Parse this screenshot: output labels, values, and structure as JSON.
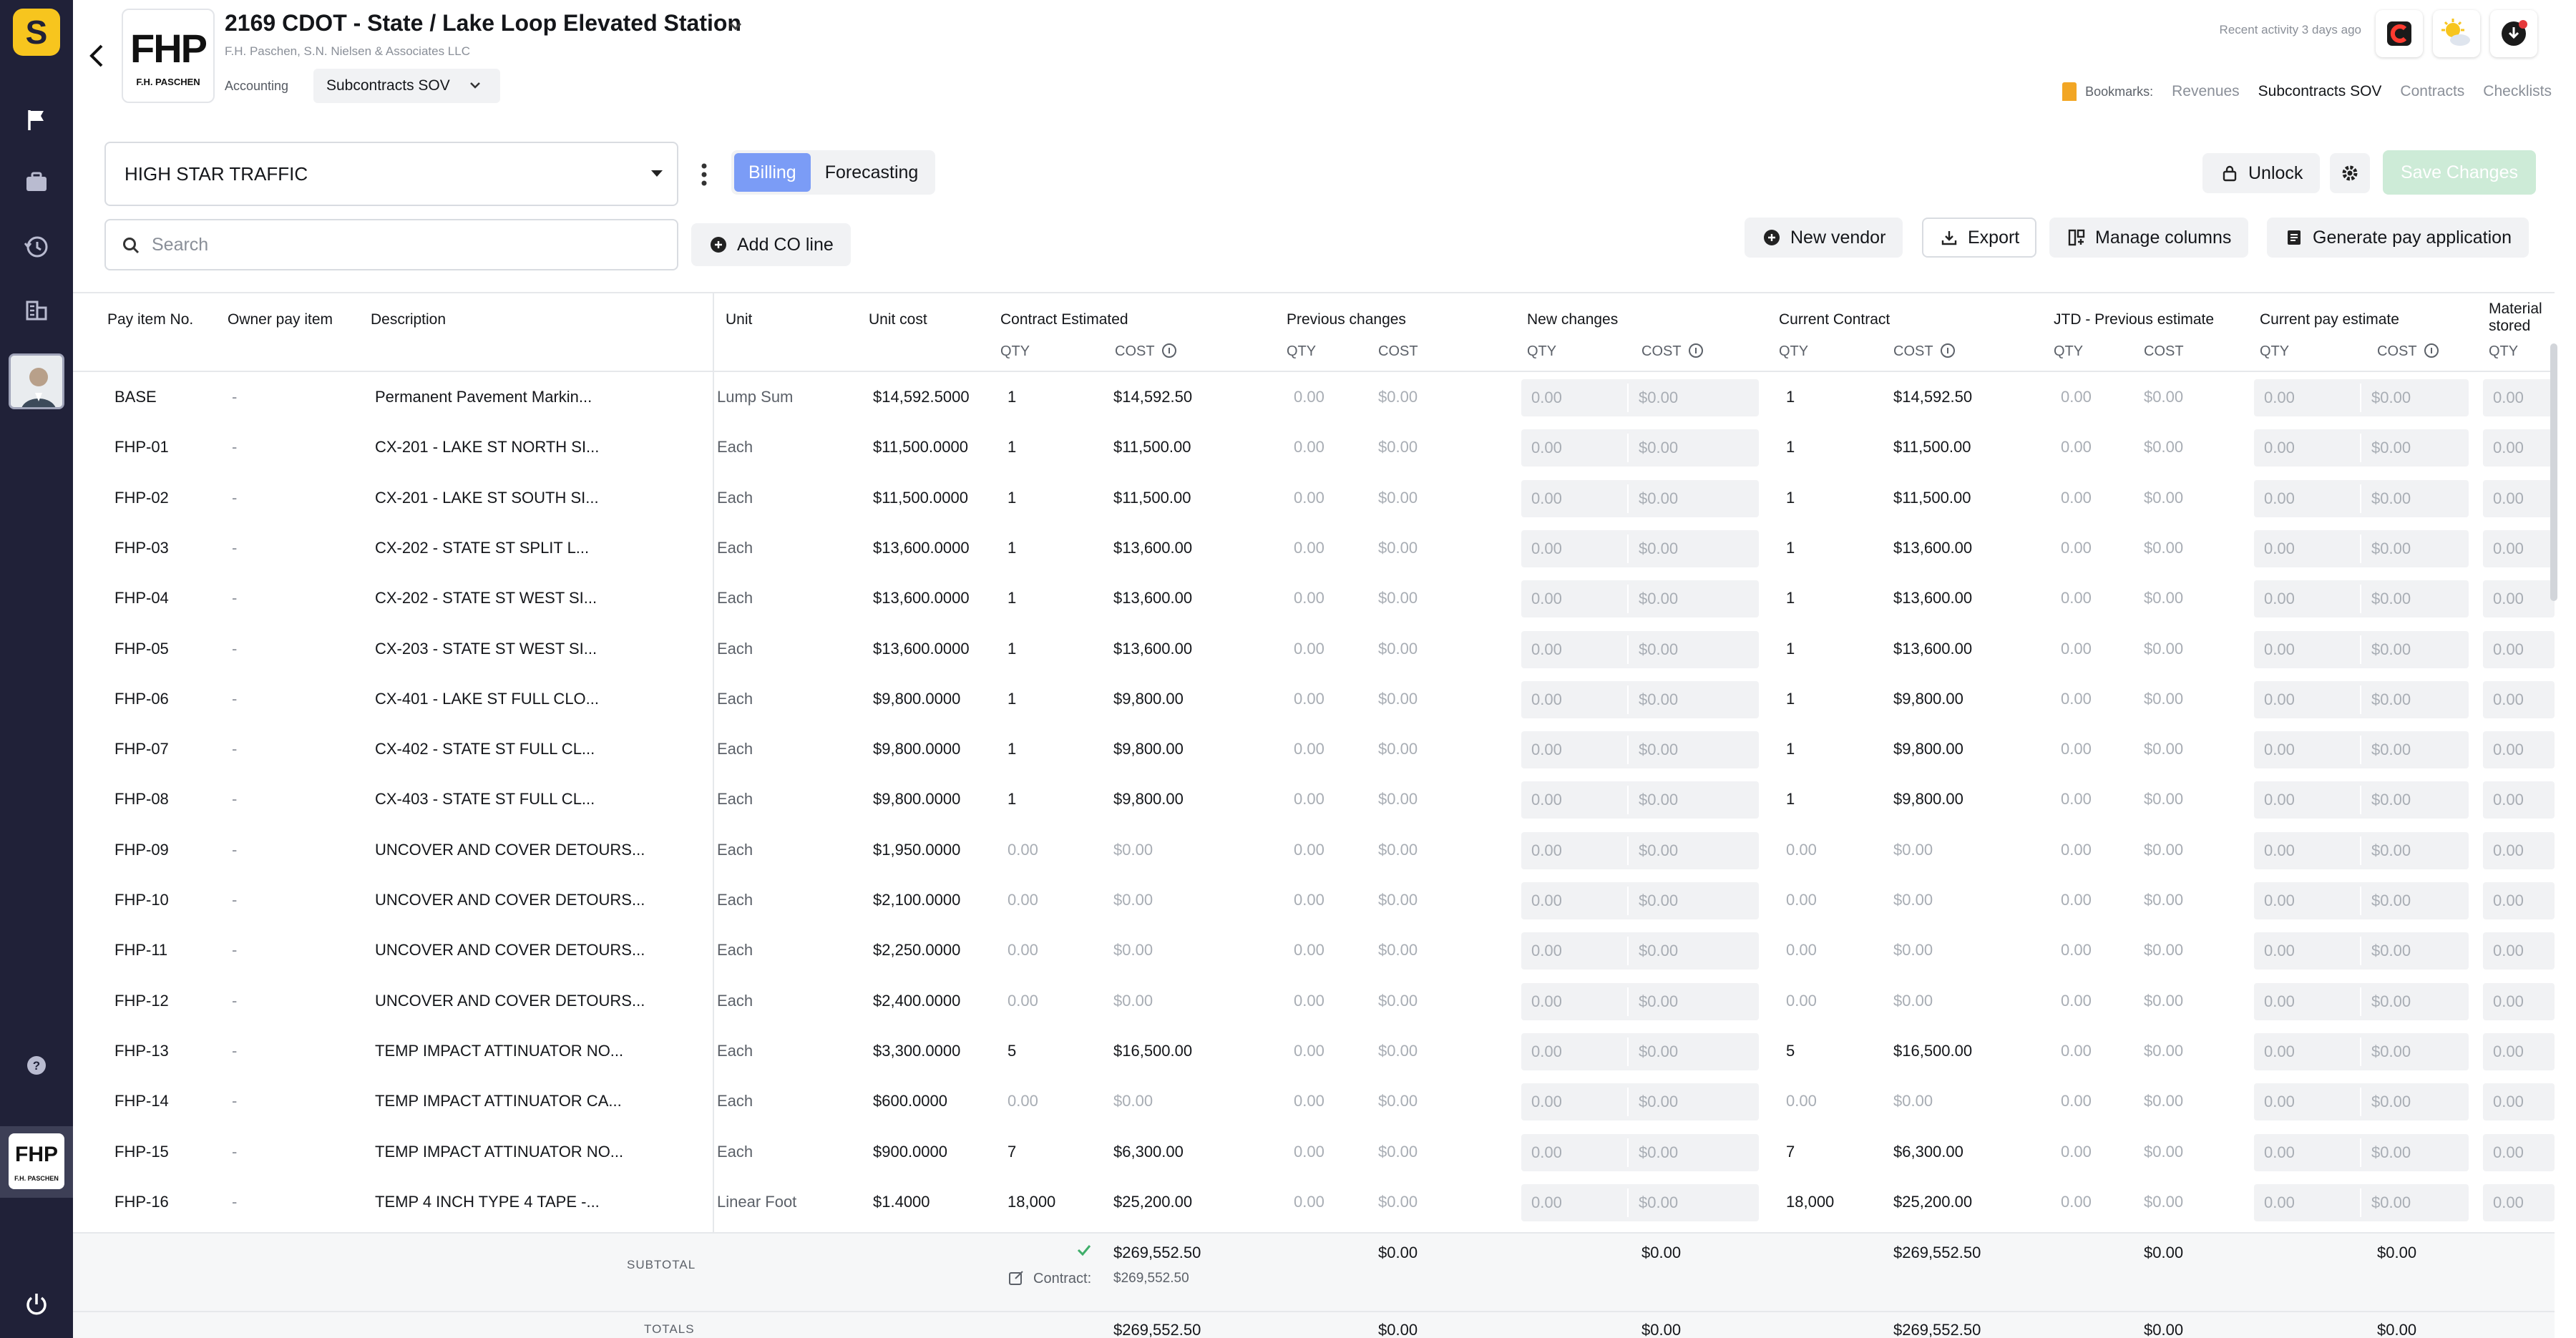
{
  "project": {
    "title": "2169 CDOT - State / Lake Loop Elevated Station",
    "subtitle": "F.H. Paschen, S.N. Nielsen & Associates LLC",
    "logo_text": "FHP",
    "logo_caption": "F.H. PASCHEN",
    "category": "Accounting",
    "section": "Subcontracts SOV"
  },
  "header": {
    "recent_activity": "Recent activity 3 days ago",
    "bookmarks_label": "Bookmarks:",
    "bookmarks": [
      "Revenues",
      "Subcontracts SOV",
      "Contracts",
      "Checklists"
    ],
    "active_bookmark": "Subcontracts SOV"
  },
  "app": {
    "logo_letter": "S",
    "company_logo_text": "FHP",
    "company_logo_caption": "F.H. PASCHEN"
  },
  "toolbar": {
    "vendor": "HIGH STAR TRAFFIC",
    "tabs": [
      "Billing",
      "Forecasting"
    ],
    "active_tab": "Billing",
    "unlock_label": "Unlock",
    "save_label": "Save Changes",
    "search_placeholder": "Search",
    "add_co_label": "Add CO line",
    "new_vendor_label": "New vendor",
    "export_label": "Export",
    "manage_columns_label": "Manage columns",
    "generate_pay_label": "Generate pay application"
  },
  "table": {
    "columns": {
      "pay_item": "Pay item No.",
      "owner_pay_item": "Owner pay item",
      "description": "Description",
      "unit": "Unit",
      "unit_cost": "Unit cost",
      "contract_estimated": "Contract Estimated",
      "previous_changes": "Previous changes",
      "new_changes": "New changes",
      "current_contract": "Current Contract",
      "jtd_previous": "JTD - Previous estimate",
      "current_pay": "Current pay estimate",
      "material_stored": "Material stored",
      "qty": "QTY",
      "cost": "COST"
    },
    "rows": [
      {
        "no": "BASE",
        "owner": "-",
        "desc": "Permanent Pavement Markin...",
        "unit": "Lump Sum",
        "unit_cost": "$14,592.5000",
        "ce_qty": "1",
        "ce_cost": "$14,592.50",
        "cc_qty": "1",
        "cc_cost": "$14,592.50"
      },
      {
        "no": "FHP-01",
        "owner": "-",
        "desc": "CX-201 - LAKE ST NORTH SI...",
        "unit": "Each",
        "unit_cost": "$11,500.0000",
        "ce_qty": "1",
        "ce_cost": "$11,500.00",
        "cc_qty": "1",
        "cc_cost": "$11,500.00"
      },
      {
        "no": "FHP-02",
        "owner": "-",
        "desc": "CX-201 - LAKE ST SOUTH SI...",
        "unit": "Each",
        "unit_cost": "$11,500.0000",
        "ce_qty": "1",
        "ce_cost": "$11,500.00",
        "cc_qty": "1",
        "cc_cost": "$11,500.00"
      },
      {
        "no": "FHP-03",
        "owner": "-",
        "desc": "CX-202 - STATE ST SPLIT L...",
        "unit": "Each",
        "unit_cost": "$13,600.0000",
        "ce_qty": "1",
        "ce_cost": "$13,600.00",
        "cc_qty": "1",
        "cc_cost": "$13,600.00"
      },
      {
        "no": "FHP-04",
        "owner": "-",
        "desc": "CX-202 - STATE ST WEST SI...",
        "unit": "Each",
        "unit_cost": "$13,600.0000",
        "ce_qty": "1",
        "ce_cost": "$13,600.00",
        "cc_qty": "1",
        "cc_cost": "$13,600.00"
      },
      {
        "no": "FHP-05",
        "owner": "-",
        "desc": "CX-203 - STATE ST WEST SI...",
        "unit": "Each",
        "unit_cost": "$13,600.0000",
        "ce_qty": "1",
        "ce_cost": "$13,600.00",
        "cc_qty": "1",
        "cc_cost": "$13,600.00"
      },
      {
        "no": "FHP-06",
        "owner": "-",
        "desc": "CX-401 - LAKE ST FULL CLO...",
        "unit": "Each",
        "unit_cost": "$9,800.0000",
        "ce_qty": "1",
        "ce_cost": "$9,800.00",
        "cc_qty": "1",
        "cc_cost": "$9,800.00"
      },
      {
        "no": "FHP-07",
        "owner": "-",
        "desc": "CX-402 - STATE ST FULL CL...",
        "unit": "Each",
        "unit_cost": "$9,800.0000",
        "ce_qty": "1",
        "ce_cost": "$9,800.00",
        "cc_qty": "1",
        "cc_cost": "$9,800.00"
      },
      {
        "no": "FHP-08",
        "owner": "-",
        "desc": "CX-403 - STATE ST FULL CL...",
        "unit": "Each",
        "unit_cost": "$9,800.0000",
        "ce_qty": "1",
        "ce_cost": "$9,800.00",
        "cc_qty": "1",
        "cc_cost": "$9,800.00"
      },
      {
        "no": "FHP-09",
        "owner": "-",
        "desc": "UNCOVER AND COVER DETOURS...",
        "unit": "Each",
        "unit_cost": "$1,950.0000",
        "ce_qty": "0.00",
        "ce_cost": "$0.00",
        "cc_qty": "0.00",
        "cc_cost": "$0.00"
      },
      {
        "no": "FHP-10",
        "owner": "-",
        "desc": "UNCOVER AND COVER DETOURS...",
        "unit": "Each",
        "unit_cost": "$2,100.0000",
        "ce_qty": "0.00",
        "ce_cost": "$0.00",
        "cc_qty": "0.00",
        "cc_cost": "$0.00"
      },
      {
        "no": "FHP-11",
        "owner": "-",
        "desc": "UNCOVER AND COVER DETOURS...",
        "unit": "Each",
        "unit_cost": "$2,250.0000",
        "ce_qty": "0.00",
        "ce_cost": "$0.00",
        "cc_qty": "0.00",
        "cc_cost": "$0.00"
      },
      {
        "no": "FHP-12",
        "owner": "-",
        "desc": "UNCOVER AND COVER DETOURS...",
        "unit": "Each",
        "unit_cost": "$2,400.0000",
        "ce_qty": "0.00",
        "ce_cost": "$0.00",
        "cc_qty": "0.00",
        "cc_cost": "$0.00"
      },
      {
        "no": "FHP-13",
        "owner": "-",
        "desc": "TEMP IMPACT ATTINUATOR NO...",
        "unit": "Each",
        "unit_cost": "$3,300.0000",
        "ce_qty": "5",
        "ce_cost": "$16,500.00",
        "cc_qty": "5",
        "cc_cost": "$16,500.00"
      },
      {
        "no": "FHP-14",
        "owner": "-",
        "desc": "TEMP IMPACT ATTINUATOR CA...",
        "unit": "Each",
        "unit_cost": "$600.0000",
        "ce_qty": "0.00",
        "ce_cost": "$0.00",
        "cc_qty": "0.00",
        "cc_cost": "$0.00"
      },
      {
        "no": "FHP-15",
        "owner": "-",
        "desc": "TEMP IMPACT ATTINUATOR NO...",
        "unit": "Each",
        "unit_cost": "$900.0000",
        "ce_qty": "7",
        "ce_cost": "$6,300.00",
        "cc_qty": "7",
        "cc_cost": "$6,300.00"
      },
      {
        "no": "FHP-16",
        "owner": "-",
        "desc": "TEMP 4 INCH TYPE 4 TAPE -...",
        "unit": "Linear Foot",
        "unit_cost": "$1.4000",
        "ce_qty": "18,000",
        "ce_cost": "$25,200.00",
        "cc_qty": "18,000",
        "cc_cost": "$25,200.00"
      }
    ],
    "zero_qty": "0.00",
    "zero_cost": "$0.00"
  },
  "subtotal": {
    "label": "SUBTOTAL",
    "contract_estimated": "$269,552.50",
    "contract_label": "Contract:",
    "contract_value": "$269,552.50",
    "previous_changes": "$0.00",
    "new_changes": "$0.00",
    "current_contract": "$269,552.50",
    "jtd_previous": "$0.00",
    "current_pay": "$0.00"
  },
  "totals": {
    "label": "TOTALS",
    "contract_estimated": "$269,552.50",
    "previous_changes": "$0.00",
    "new_changes": "$0.00",
    "current_contract": "$269,552.50",
    "jtd_previous": "$0.00",
    "current_pay": "$0.00"
  }
}
